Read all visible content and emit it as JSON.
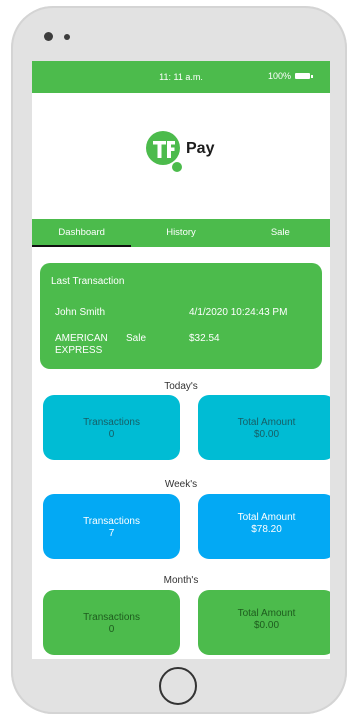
{
  "status_bar": {
    "time": "11: 11 a.m.",
    "battery": "100%"
  },
  "logo": {
    "text": "Pay",
    "letters": "TF"
  },
  "tabs": [
    {
      "label": "Dashboard",
      "active": true
    },
    {
      "label": "History",
      "active": false
    },
    {
      "label": "Sale",
      "active": false
    }
  ],
  "last_transaction": {
    "title": "Last Transaction",
    "name": "John Smith",
    "date": "4/1/2020 10:24:43 PM",
    "card_type": "AMERICAN EXPRESS",
    "kind": "Sale",
    "amount": "$32.54"
  },
  "periods": [
    {
      "label": "Today's",
      "transactions_label": "Transactions",
      "transactions": "0",
      "amount_label": "Total Amount",
      "amount": "$0.00"
    },
    {
      "label": "Week's",
      "transactions_label": "Transactions",
      "transactions": "7",
      "amount_label": "Total Amount",
      "amount": "$78.20"
    },
    {
      "label": "Month's",
      "transactions_label": "Transactions",
      "transactions": "0",
      "amount_label": "Total Amount",
      "amount": "$0.00"
    }
  ],
  "colors": {
    "brand_green": "#4cbb4c",
    "teal": "#00bcd4",
    "blue": "#03a9f4"
  }
}
